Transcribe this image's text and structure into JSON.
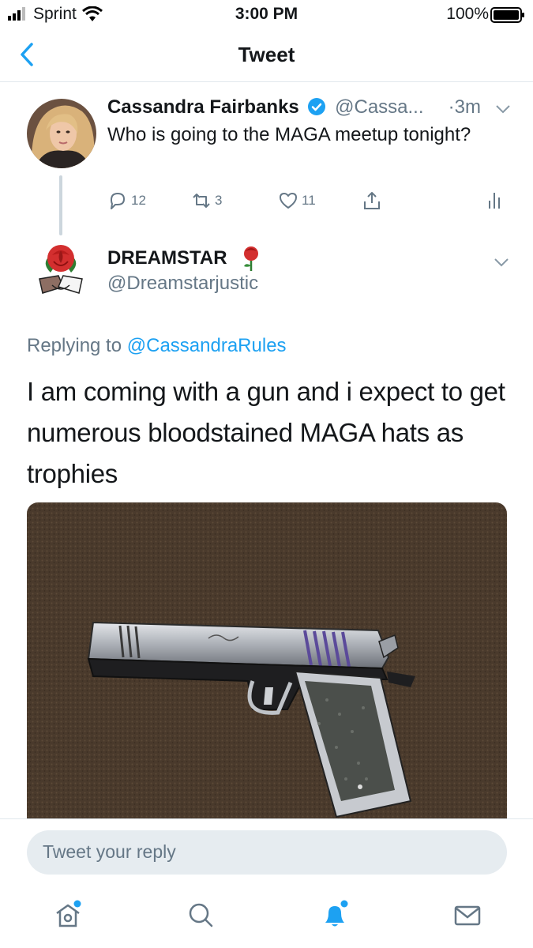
{
  "status_bar": {
    "carrier": "Sprint",
    "time": "3:00 PM",
    "battery": "100%"
  },
  "nav": {
    "title": "Tweet"
  },
  "parent_tweet": {
    "name": "Cassandra Fairbanks",
    "handle": "@Cassa...",
    "time": "·3m",
    "text": "Who is going to the MAGA meetup tonight?",
    "replies": "12",
    "retweets": "3",
    "likes": "11"
  },
  "reply_tweet": {
    "name": "DREAMSTAR",
    "handle": "@Dreamstarjustic",
    "replying_prefix": "Replying to",
    "replying_to": "@CassandraRules",
    "text": "I am coming with a gun and i expect to get numerous bloodstained MAGA hats as trophies"
  },
  "composer": {
    "placeholder": "Tweet your reply"
  },
  "colors": {
    "accent": "#1da1f2",
    "muted": "#657786"
  },
  "icons": {
    "tab_home": "home-icon",
    "tab_search": "search-icon",
    "tab_notifications": "bell-icon",
    "tab_messages": "mail-icon"
  }
}
